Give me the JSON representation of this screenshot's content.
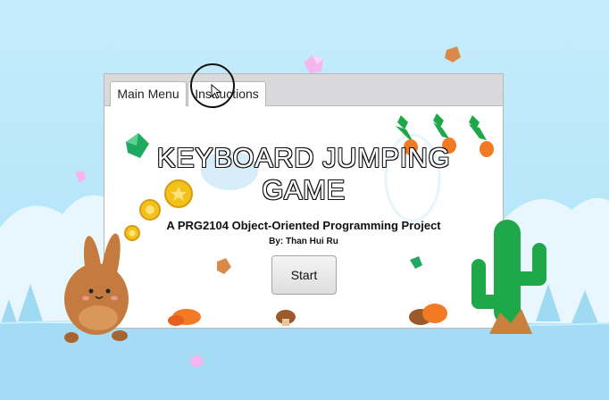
{
  "tabs": [
    {
      "label": "Main Menu"
    },
    {
      "label": "Instructions"
    }
  ],
  "game": {
    "title_line1": "KEYBOARD JUMPING",
    "title_line2": "GAME",
    "subtitle": "A PRG2104 Object-Oriented Programming Project",
    "author": "By: Than Hui Ru",
    "start_label": "Start"
  },
  "colors": {
    "sky": "#b7e6fa",
    "cactus": "#1fa84a",
    "bunny": "#c57b3f",
    "coin": "#f2c21b",
    "carrot": "#f27a24",
    "gem": "#22b06a"
  },
  "icons": [
    "bunny-character",
    "cactus",
    "carrot-icon",
    "coin-icon",
    "gem-icon",
    "mushroom-icon",
    "cursor-ring"
  ]
}
